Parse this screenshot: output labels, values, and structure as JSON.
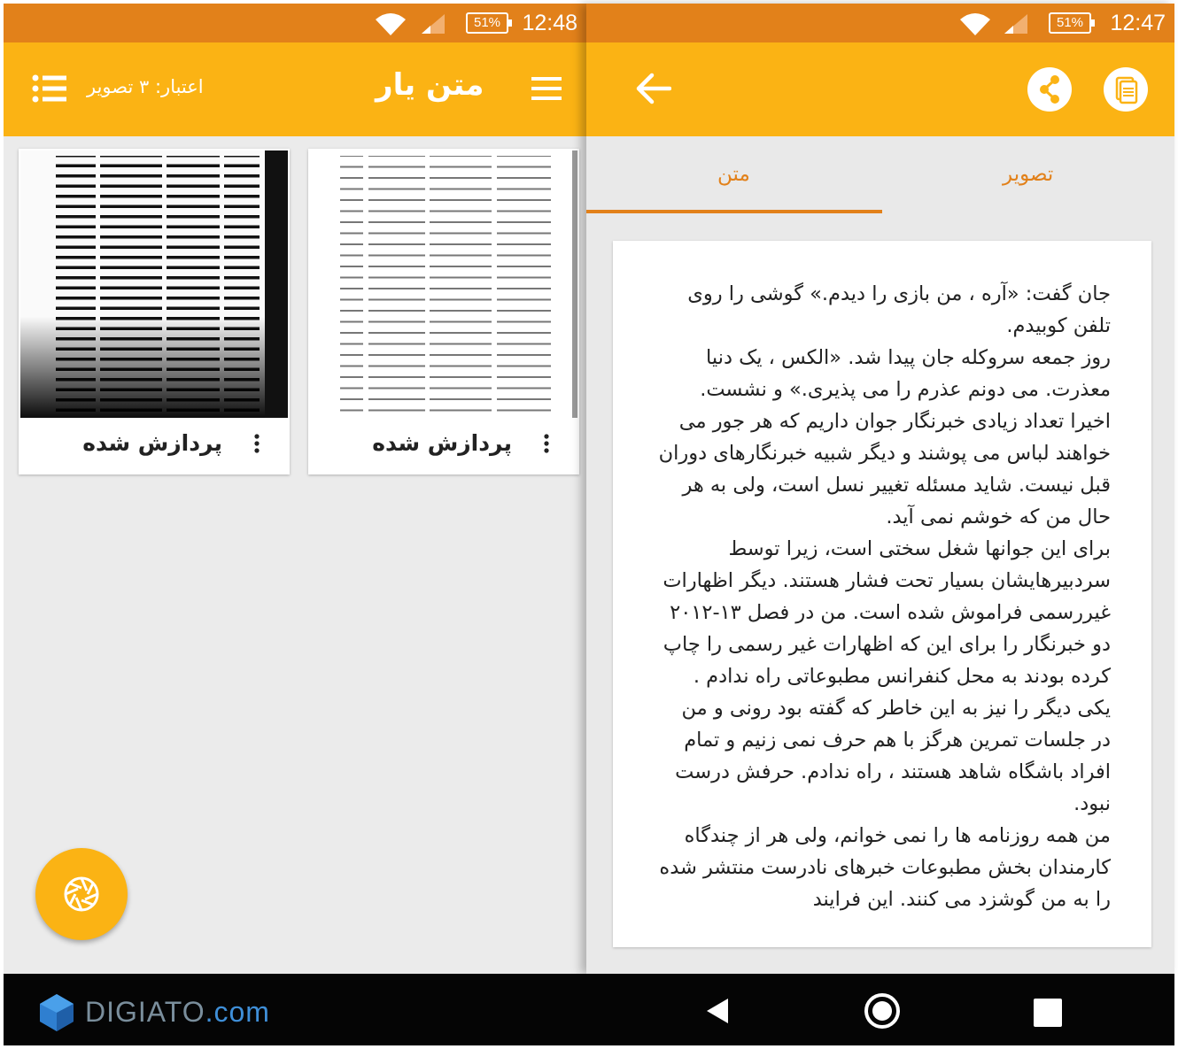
{
  "left_screen": {
    "status": {
      "time": "12:48",
      "battery": "51%"
    },
    "app_bar": {
      "title": "متن یار",
      "credit": "اعتبار: ۳ تصویر"
    },
    "cards": [
      {
        "label": "پردازش شده"
      },
      {
        "label": "پردازش شده"
      }
    ]
  },
  "right_screen": {
    "status": {
      "time": "12:47",
      "battery": "51%"
    },
    "tabs": {
      "image": "تصویر",
      "text": "متن"
    },
    "ocr_text": "جان گفت: «آره ، من بازی را دیدم.» گوشی را روی تلفن کوبیدم.\nروز جمعه سروکله جان پیدا شد. «الکس ، یک دنیا معذرت. می دونم عذرم را می پذیری.» و نشست.\nاخیرا تعداد زیادی خبرنگار جوان داریم که هر جور می خواهند لباس می پوشند و دیگر شبیه خبرنگارهای دوران قبل نیست. شاید مسئله تغییر نسل است، ولی به هر حال من که خوشم نمی آید.\nبرای این جوانها شغل سختی است، زیرا توسط سردبیرهایشان بسیار تحت فشار هستند. دیگر اظهارات غیررسمی فراموش شده است. من در فصل ۱۳-۲۰۱۲ دو خبرنگار را برای این که اظهارات غیر رسمی را چاپ کرده بودند به محل کنفرانس مطبوعاتی راه ندادم . یکی دیگر را نیز به این خاطر که گفته بود رونی و من در جلسات تمرین هرگز با هم حرف نمی زنیم و تمام افراد باشگاه شاهد هستند ، راه ندادم. حرفش درست نبود.\nمن همه روزنامه ها را نمی خوانم، ولی هر از چندگاه کارمندان بخش مطبوعات خبرهای نادرست منتشر شده را به من گوشزد می کنند. این فرایند"
  },
  "navigation": {
    "watermark_main": "DIGIATO",
    "watermark_tld": ".com"
  },
  "colors": {
    "status_bar": "#e2811a",
    "app_bar": "#fbb314",
    "accent": "#e2811a",
    "nav_bar": "#050505"
  },
  "icons": [
    "wifi-icon",
    "signal-icon",
    "battery-icon",
    "menu-icon",
    "list-icon",
    "more-vert-icon",
    "camera-shutter-icon",
    "back-arrow-icon",
    "share-icon",
    "document-icon",
    "nav-back-icon",
    "nav-home-icon",
    "nav-recent-icon",
    "digiato-logo"
  ]
}
